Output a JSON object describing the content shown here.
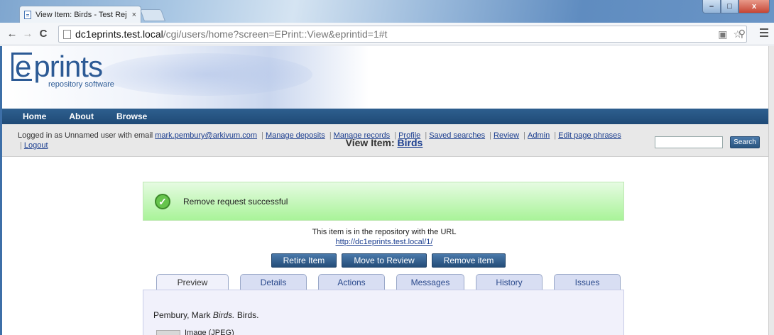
{
  "browser": {
    "tab_title": "View Item: Birds - Test Rej",
    "tab_close": "×",
    "url_host": "dc1eprints.test.local",
    "url_path": "/cgi/users/home?screen=EPrint::View&eprintid=1#t"
  },
  "site": {
    "logo_word": "prints",
    "logo_e": "e",
    "logo_sub": "repository software",
    "menu": [
      "Home",
      "About",
      "Browse"
    ]
  },
  "login": {
    "prefix": "Logged in as Unnamed user with email",
    "email": "mark.pembury@arkivum.com",
    "links": [
      "Manage deposits",
      "Manage records",
      "Profile",
      "Saved searches",
      "Review",
      "Admin",
      "Edit page phrases",
      "Logout"
    ],
    "search_button": "Search"
  },
  "page": {
    "title_prefix": "View Item:",
    "title_link": "Birds",
    "message": "Remove request successful",
    "url_info": "This item is in the repository with the URL",
    "item_url": "http://dc1eprints.test.local/1/",
    "buttons": [
      "Retire Item",
      "Move to Review",
      "Remove item"
    ],
    "tabs": [
      "Preview",
      "Details",
      "Actions",
      "Messages",
      "History",
      "Issues"
    ],
    "citation_author": "Pembury, Mark",
    "citation_title": "Birds.",
    "citation_rest": "Birds.",
    "doc_type": "Image (JPEG)"
  }
}
